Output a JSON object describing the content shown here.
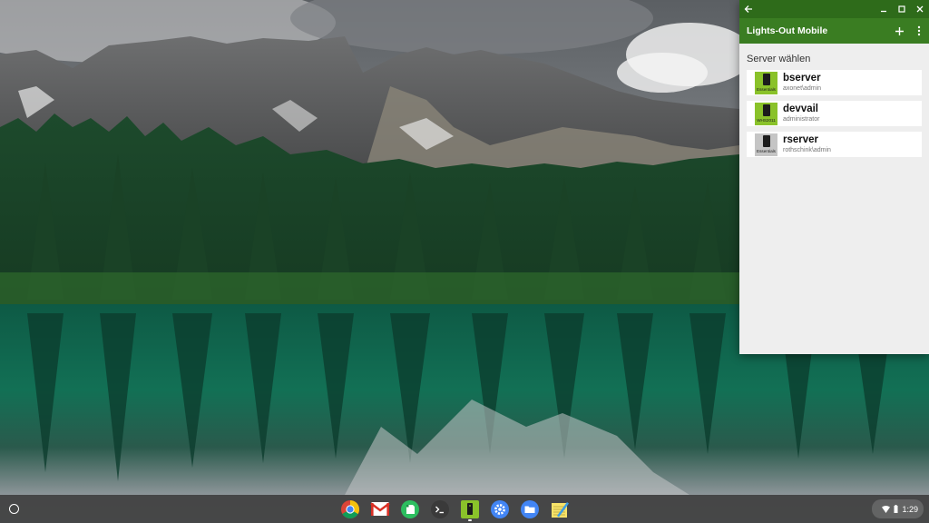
{
  "window": {
    "title": "Lights-Out Mobile",
    "back_icon": "arrow-left-icon",
    "controls": [
      "minimize-icon",
      "maximize-icon",
      "close-icon"
    ]
  },
  "toolbar": {
    "add_icon": "plus-icon",
    "menu_icon": "more-vert-icon"
  },
  "server_list": {
    "heading": "Server wählen",
    "items": [
      {
        "name": "bserver",
        "user": "axonet\\admin",
        "edition": "Essentials",
        "status": "online"
      },
      {
        "name": "devvail",
        "user": "administrator",
        "edition": "WHS2011",
        "status": "online"
      },
      {
        "name": "rserver",
        "user": "rothschink\\admin",
        "edition": "Essentials",
        "status": "offline"
      }
    ]
  },
  "colors": {
    "title_bar": "#2e6b1a",
    "app_bar": "#3a7d22",
    "online_icon": "#8ac22a",
    "offline_icon": "#c5c5c5"
  },
  "shelf": {
    "launcher_icon": "launcher-icon",
    "apps": [
      "chrome-icon",
      "gmail-icon",
      "evernote-icon",
      "terminal-icon",
      "lights-out-icon",
      "settings-icon",
      "files-icon",
      "notepad-icon"
    ],
    "active_app": "lights-out-icon",
    "status": {
      "time": "1:29",
      "wifi_icon": "wifi-icon",
      "battery_icon": "battery-icon"
    }
  }
}
